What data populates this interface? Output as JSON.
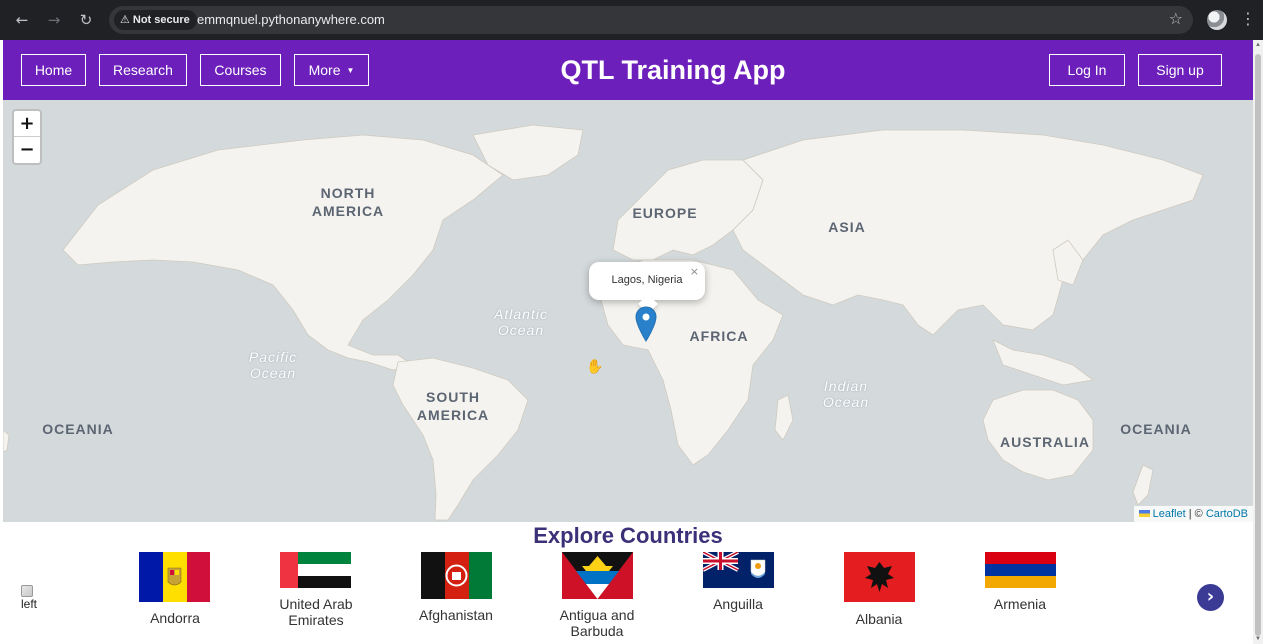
{
  "browser": {
    "security_label": "Not secure",
    "url": "emmqnuel.pythonanywhere.com",
    "icons": [
      "back-arrow-icon",
      "forward-arrow-icon",
      "reload-icon",
      "warning-icon",
      "star-icon",
      "profile-icon",
      "kebab-menu-icon"
    ]
  },
  "header": {
    "nav": [
      {
        "label": "Home"
      },
      {
        "label": "Research"
      },
      {
        "label": "Courses"
      },
      {
        "label": "More"
      }
    ],
    "title": "QTL Training App",
    "login": "Log In",
    "signup": "Sign up",
    "background": "#6c1fba"
  },
  "map": {
    "zoom_in": "+",
    "zoom_out": "−",
    "popup": {
      "text": "Lagos, Nigeria",
      "close": "×"
    },
    "continents": {
      "north_america": "NORTH\nAMERICA",
      "europe": "EUROPE",
      "asia": "ASIA",
      "africa": "AFRICA",
      "south_america": "SOUTH\nAMERICA",
      "oceania_left": "OCEANIA",
      "oceania_right": "OCEANIA",
      "australia": "AUSTRALIA"
    },
    "oceans": {
      "atlantic": "Atlantic\nOcean",
      "pacific": "Pacific\nOcean",
      "indian": "Indian\nOcean"
    },
    "attribution": {
      "leaflet": "Leaflet",
      "separator": " | © ",
      "carto": "CartoDB"
    }
  },
  "explore": {
    "title": "Explore Countries",
    "left_alt": "left",
    "countries": [
      {
        "name": "Andorra"
      },
      {
        "name": "United Arab Emirates"
      },
      {
        "name": "Afghanistan"
      },
      {
        "name": "Antigua and Barbuda"
      },
      {
        "name": "Anguilla"
      },
      {
        "name": "Albania"
      },
      {
        "name": "Armenia"
      }
    ],
    "next": "›"
  }
}
